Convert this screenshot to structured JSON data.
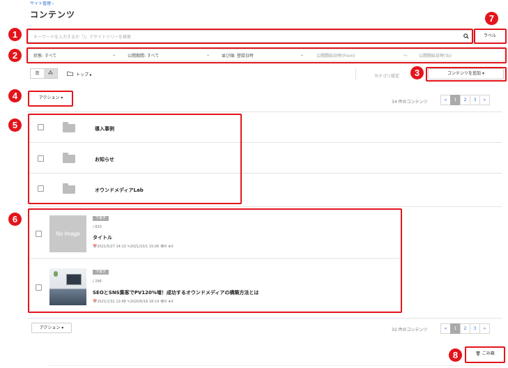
{
  "breadcrumb": "サイト管理 ›",
  "page_title": "コンテンツ",
  "search": {
    "placeholder": "キーワードを入力するか「/」でサイトツリーを検索",
    "search_icon": "search-icon"
  },
  "label_button": "ラベル",
  "filters": {
    "status": "状態: すべて",
    "period": "公開期間: すべて",
    "sort": "並び順: 登録日時",
    "from": "公開開始日時(From)",
    "separator": "〜",
    "to": "公開開始日時(To)"
  },
  "toolbar": {
    "root": "トップ ▸",
    "category_settings": "カテゴリ設定",
    "add_content": "コンテンツを追加 ▾"
  },
  "action_label": "アクション ▾",
  "count_label": "34 件のコンテンツ",
  "count_label_bottom": "32 件のコンテンツ",
  "pager": {
    "prev": "«",
    "pages": [
      "1",
      "2",
      "3"
    ],
    "next": "»"
  },
  "folders": [
    {
      "name": "導入事例"
    },
    {
      "name": "お知らせ"
    },
    {
      "name": "オウンドメディアLab"
    }
  ],
  "contents": [
    {
      "tag": "下書き",
      "path": "/ 820",
      "title": "タイトル",
      "meta": "📅2021/5/27 14:13 ✎2021/10/1 15:06 👁0 ★0",
      "thumb_text": "No Image"
    },
    {
      "tag": "下書き",
      "path": "/ 266",
      "title": "SEOとSNS集客でPV120%増！成功するオウンドメディアの構築方法とは",
      "meta": "📅2021/1/31 12:48 ✎2020/6/16 18:14 👁0 ★0",
      "thumb_text": ""
    }
  ],
  "trash_button": "ごみ箱",
  "callouts": [
    "1",
    "2",
    "3",
    "4",
    "5",
    "6",
    "7",
    "8"
  ],
  "accent_color": "#e3141b"
}
